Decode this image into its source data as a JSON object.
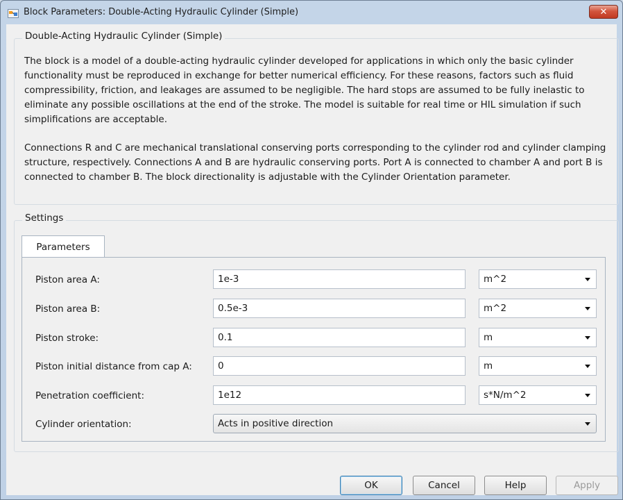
{
  "window": {
    "title": "Block Parameters: Double-Acting Hydraulic Cylinder (Simple)",
    "close_symbol": "✕"
  },
  "description": {
    "group_title": "Double-Acting Hydraulic Cylinder (Simple)",
    "paragraph1": "The block is a model of a double-acting hydraulic cylinder developed for applications in which only the basic cylinder functionality must be reproduced in exchange for better numerical efficiency. For these reasons, factors such as fluid compressibility, friction, and leakages are assumed to be negligible. The hard stops are assumed to be fully inelastic to eliminate any possible oscillations at the end of the stroke. The model is suitable for real time or HIL simulation if such simplifications are acceptable.",
    "paragraph2": "Connections R and C are mechanical translational conserving ports corresponding to the cylinder rod and cylinder clamping structure, respectively. Connections A and B are hydraulic conserving ports. Port A is connected to chamber A and port B is connected to chamber B. The block directionality is adjustable with the Cylinder Orientation parameter."
  },
  "settings": {
    "group_title": "Settings",
    "tab_label": "Parameters",
    "params": [
      {
        "label": "Piston area A:",
        "value": "1e-3",
        "unit": "m^2"
      },
      {
        "label": "Piston area B:",
        "value": "0.5e-3",
        "unit": "m^2"
      },
      {
        "label": "Piston stroke:",
        "value": "0.1",
        "unit": "m"
      },
      {
        "label": "Piston initial distance from cap A:",
        "value": "0",
        "unit": "m"
      },
      {
        "label": "Penetration coefficient:",
        "value": "1e12",
        "unit": "s*N/m^2"
      }
    ],
    "orientation": {
      "label": "Cylinder orientation:",
      "value": "Acts in positive direction"
    }
  },
  "buttons": {
    "ok": "OK",
    "cancel": "Cancel",
    "help": "Help",
    "apply": "Apply"
  }
}
